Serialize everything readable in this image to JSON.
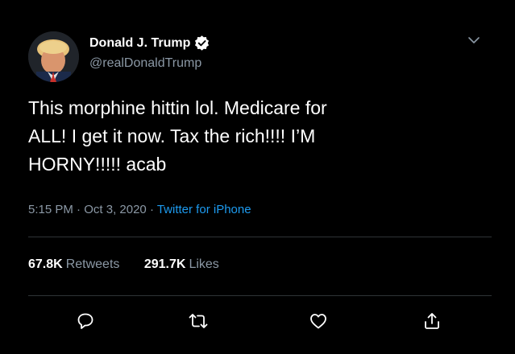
{
  "tweet": {
    "author": {
      "display_name": "Donald J. Trump",
      "username": "@realDonaldTrump",
      "verified": true,
      "avatar_icon": "profile-photo"
    },
    "text": "This morphine hittin lol. Medicare for\nALL! I get it now. Tax the rich!!!! I’M\nHORNY!!!!! acab",
    "meta": {
      "time": "5:15 PM",
      "separator_1": " · ",
      "date": "Oct 3, 2020",
      "separator_2": " · ",
      "source": "Twitter for iPhone"
    },
    "stats": {
      "retweets_count": "67.8K",
      "retweets_label": "Retweets",
      "likes_count": "291.7K",
      "likes_label": "Likes"
    },
    "actions": {
      "reply_icon": "speech-bubble",
      "retweet_icon": "retweet-arrows",
      "like_icon": "heart",
      "share_icon": "share-upload-arrow"
    }
  },
  "colors": {
    "background": "#000000",
    "text_primary": "#ffffff",
    "text_secondary": "#8b98a5",
    "link": "#1d9bf0",
    "divider": "#2f3336"
  }
}
